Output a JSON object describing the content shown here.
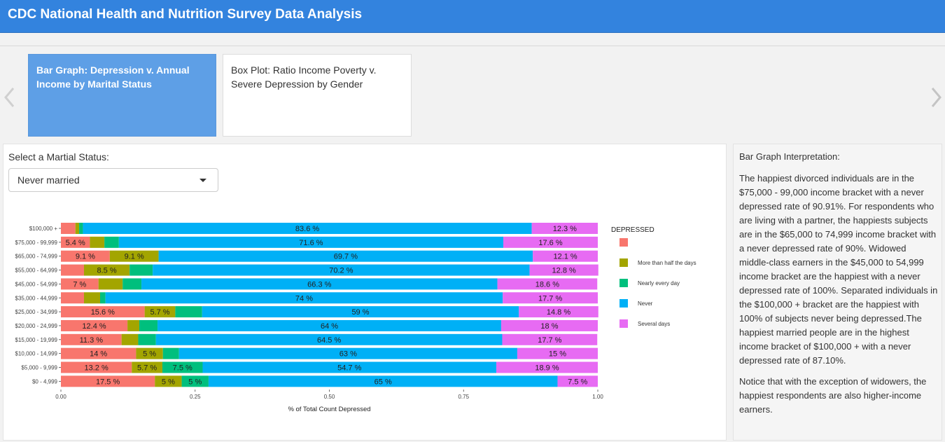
{
  "header": {
    "title": "CDC National Health and Nutrition Survey Data Analysis"
  },
  "carousel": {
    "cards": [
      {
        "label": "Bar Graph: Depression v. Annual Income by Marital Status"
      },
      {
        "label": "Box Plot: Ratio Income Poverty v. Severe Depression by Gender"
      }
    ]
  },
  "filter": {
    "label": "Select a Martial Status:",
    "selected": "Never married"
  },
  "interpretation": {
    "title": "Bar Graph Interpretation:",
    "paragraph1": "The happiest divorced individuals are in the $75,000 - 99,000 income bracket with a never depressed rate of 90.91%. For respondents who are living with a partner, the happiests subjects are in the $65,000 to 74,999 income bracket with a never depressed rate of 90%. Widowed middle-class earners in the $45,000 to 54,999 income bracket are the happiest with a never depressed rate of 100%. Separated individuals in the $100,000 + bracket are the happiest with 100% of subjects never being depressed.The happiest married people are in the highest income bracket of $100,000 + with a never depressed rate of 87.10%.",
    "paragraph2": "Notice that with the exception of widowers, the happiest respondents are also higher-income earners."
  },
  "colors": {
    "header_bg": "#3383de",
    "card_active_bg": "#5e9fe6",
    "segment_colors": [
      "#f8766d",
      "#a3a500",
      "#00bf7d",
      "#00b0f6",
      "#e76bf3"
    ]
  },
  "chart_data": {
    "type": "bar",
    "orientation": "horizontal",
    "stacked": true,
    "xlabel": "% of Total Count Depressed",
    "xlim": [
      0,
      1
    ],
    "xticks": [
      "0.00",
      "0.25",
      "0.50",
      "0.75",
      "1.00"
    ],
    "xtick_values": [
      0,
      0.25,
      0.5,
      0.75,
      1
    ],
    "legend_title": "DEPRESSED",
    "legend_position": "right",
    "categories": [
      "$100,000 +",
      "$75,000 - 99,999",
      "$65,000 - 74,999",
      "$55,000 - 64,999",
      "$45,000 - 54,999",
      "$35,000 - 44,999",
      "$25,000 - 34,999",
      "$20,000 - 24,999",
      "$15,000 - 19,999",
      "$10,000 - 14,999",
      "$5,000 - 9,999",
      "$0 - 4,999"
    ],
    "series": [
      {
        "name": "",
        "values": [
          0.027,
          0.054,
          0.091,
          0.043,
          0.07,
          0.043,
          0.156,
          0.124,
          0.113,
          0.14,
          0.132,
          0.175
        ],
        "labels": [
          "",
          "5.4 %",
          "9.1 %",
          "",
          "7 %",
          "",
          "15.6 %",
          "12.4 %",
          "11.3 %",
          "14 %",
          "13.2 %",
          "17.5 %"
        ]
      },
      {
        "name": "More than half the days",
        "values": [
          0.007,
          0.027,
          0.091,
          0.085,
          0.045,
          0.03,
          0.057,
          0.022,
          0.031,
          0.05,
          0.057,
          0.05
        ],
        "labels": [
          "",
          "",
          "9.1 %",
          "8.5 %",
          "",
          "",
          "5.7 %",
          "",
          "",
          "5 %",
          "5.7 %",
          "5 %"
        ]
      },
      {
        "name": "Nearly every day",
        "values": [
          0.007,
          0.027,
          0,
          0.043,
          0.035,
          0.01,
          0.05,
          0.034,
          0.033,
          0.03,
          0.075,
          0.05
        ],
        "labels": [
          "",
          "",
          "",
          "",
          "",
          "",
          "",
          "",
          "",
          "",
          "7.5 %",
          "5 %"
        ]
      },
      {
        "name": "Never",
        "values": [
          0.836,
          0.716,
          0.697,
          0.702,
          0.663,
          0.74,
          0.59,
          0.64,
          0.645,
          0.63,
          0.547,
          0.65
        ],
        "labels": [
          "83.6 %",
          "71.6 %",
          "69.7 %",
          "70.2 %",
          "66.3 %",
          "74 %",
          "59 %",
          "64 %",
          "64.5 %",
          "63 %",
          "54.7 %",
          "65 %"
        ]
      },
      {
        "name": "Several days",
        "values": [
          0.123,
          0.176,
          0.121,
          0.128,
          0.186,
          0.177,
          0.148,
          0.18,
          0.177,
          0.15,
          0.189,
          0.075
        ],
        "labels": [
          "12.3 %",
          "17.6 %",
          "12.1 %",
          "12.8 %",
          "18.6 %",
          "17.7 %",
          "14.8 %",
          "18 %",
          "17.7 %",
          "15 %",
          "18.9 %",
          "7.5 %"
        ]
      }
    ]
  }
}
